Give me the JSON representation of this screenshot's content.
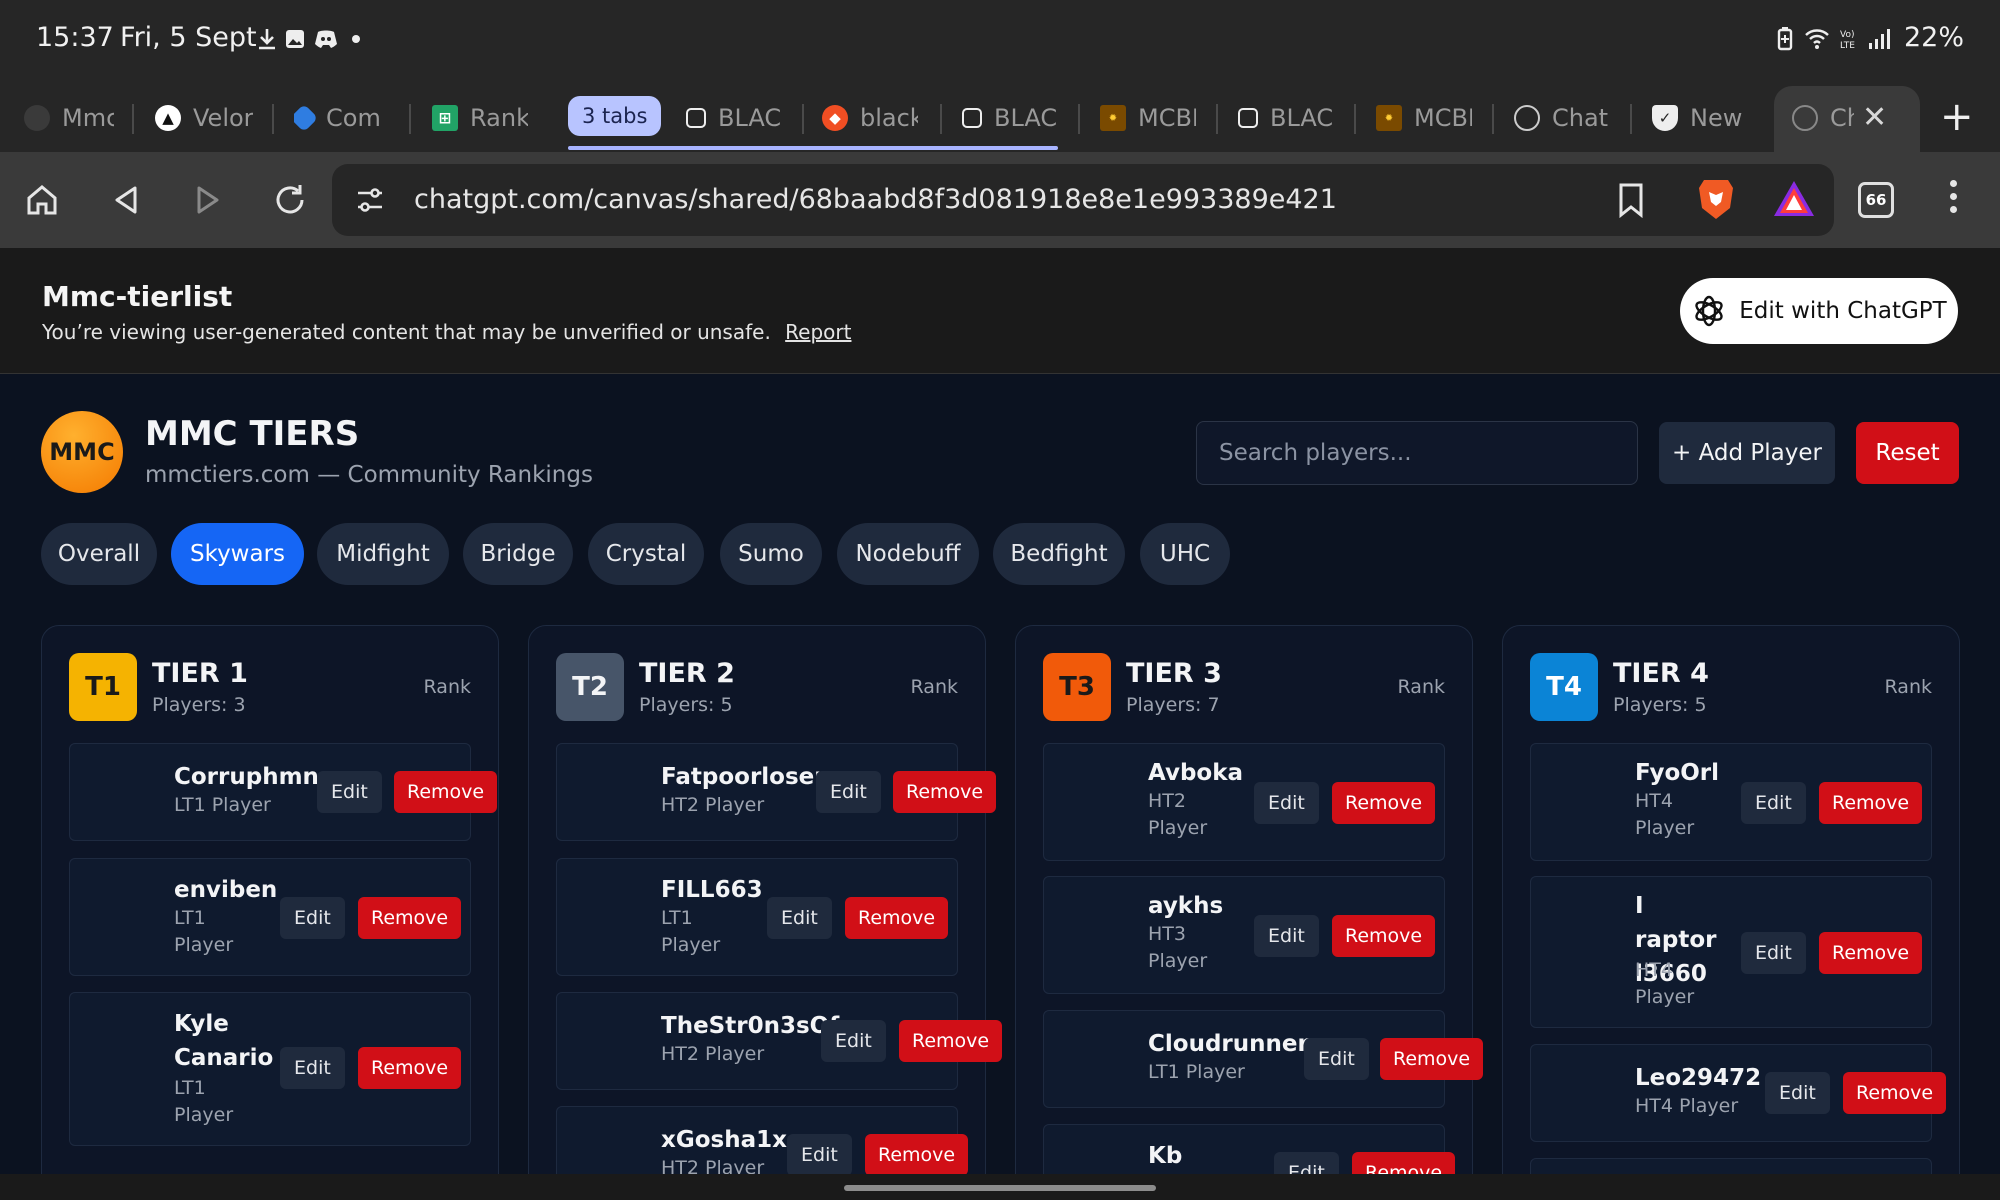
{
  "status_bar": {
    "time": "15:37",
    "date": "Fri, 5 Sept",
    "battery": "22%",
    "icons": [
      "download-icon",
      "image-icon",
      "discord-icon",
      "dot-icon",
      "battery-saver-icon",
      "wifi-icon",
      "volte-icon",
      "signal-icon"
    ]
  },
  "tabs": [
    {
      "label": "Mmc",
      "icon": "mmc-favicon"
    },
    {
      "label": "Velor",
      "icon": "velor-favicon"
    },
    {
      "label": "Com",
      "icon": "comp-favicon"
    },
    {
      "label": "Rank",
      "icon": "sheets-favicon"
    },
    {
      "label": "BLAC",
      "icon": "hex-favicon"
    },
    {
      "label": "black",
      "icon": "brave-favicon"
    },
    {
      "label": "BLAC",
      "icon": "hex-favicon"
    },
    {
      "label": "MCBI",
      "icon": "mctiers-favicon"
    },
    {
      "label": "BLAC",
      "icon": "hex-favicon"
    },
    {
      "label": "MCBI",
      "icon": "mctiers-favicon"
    },
    {
      "label": "Chat",
      "icon": "chatgpt-favicon"
    },
    {
      "label": "New",
      "icon": "shield-favicon"
    },
    {
      "label": "Ch",
      "icon": "chatgpt-favicon"
    }
  ],
  "tab_group_label": "3 tabs",
  "new_tab": "+",
  "close_tab": "✕",
  "toolbar": {
    "url": "chatgpt.com/canvas/shared/68baabd8f3d081918e8e1e993389e421",
    "tab_count": "66"
  },
  "banner": {
    "title": "Mmc-tierlist",
    "note": "You’re viewing user-generated content that may be unverified or unsafe.",
    "report": "Report",
    "edit_button": "Edit with ChatGPT"
  },
  "app": {
    "logo": "MMC",
    "title": "MMC TIERS",
    "subtitle": "mmctiers.com — Community Rankings",
    "search_placeholder": "Search players...",
    "add_player": "+ Add Player",
    "reset": "Reset",
    "modes": [
      "Overall",
      "Skywars",
      "Midfight",
      "Bridge",
      "Crystal",
      "Sumo",
      "Nodebuff",
      "Bedfight",
      "UHC"
    ],
    "active_mode": "Skywars",
    "edit_label": "Edit",
    "remove_label": "Remove",
    "rank_label": "Rank"
  },
  "tiers": [
    {
      "badge": "T1",
      "title": "TIER 1",
      "count": "Players: 3",
      "color": "#f5b301",
      "players": [
        {
          "name": "Corruphmn",
          "rank": "LT1 Player"
        },
        {
          "name": "enviben",
          "rank": "LT1 Player"
        },
        {
          "name": "Kyle Canario",
          "rank": "LT1 Player"
        }
      ]
    },
    {
      "badge": "T2",
      "title": "TIER 2",
      "count": "Players: 5",
      "color": "#475569",
      "players": [
        {
          "name": "Fatpoorloser",
          "rank": "HT2 Player"
        },
        {
          "name": "FILL663",
          "rank": "LT1 Player"
        },
        {
          "name": "TheStr0n3sOf",
          "rank": "HT2 Player"
        },
        {
          "name": "xGosha1x",
          "rank": "HT2 Player"
        }
      ]
    },
    {
      "badge": "T3",
      "title": "TIER 3",
      "count": "Players: 7",
      "color": "#f15a0a",
      "players": [
        {
          "name": "Avboka",
          "rank": "HT2 Player"
        },
        {
          "name": "aykhs",
          "rank": "HT3 Player"
        },
        {
          "name": "Cloudrunner",
          "rank": "LT1 Player"
        },
        {
          "name": "Kb",
          "rank": ""
        }
      ]
    },
    {
      "badge": "T4",
      "title": "TIER 4",
      "count": "Players: 5",
      "color": "#0b84d6",
      "players": [
        {
          "name": "FyoOrl",
          "rank": "HT4 Player"
        },
        {
          "name": "I raptor l3660",
          "rank": "HT4 Player"
        },
        {
          "name": "Leo29472",
          "rank": "HT4 Player"
        }
      ]
    }
  ]
}
